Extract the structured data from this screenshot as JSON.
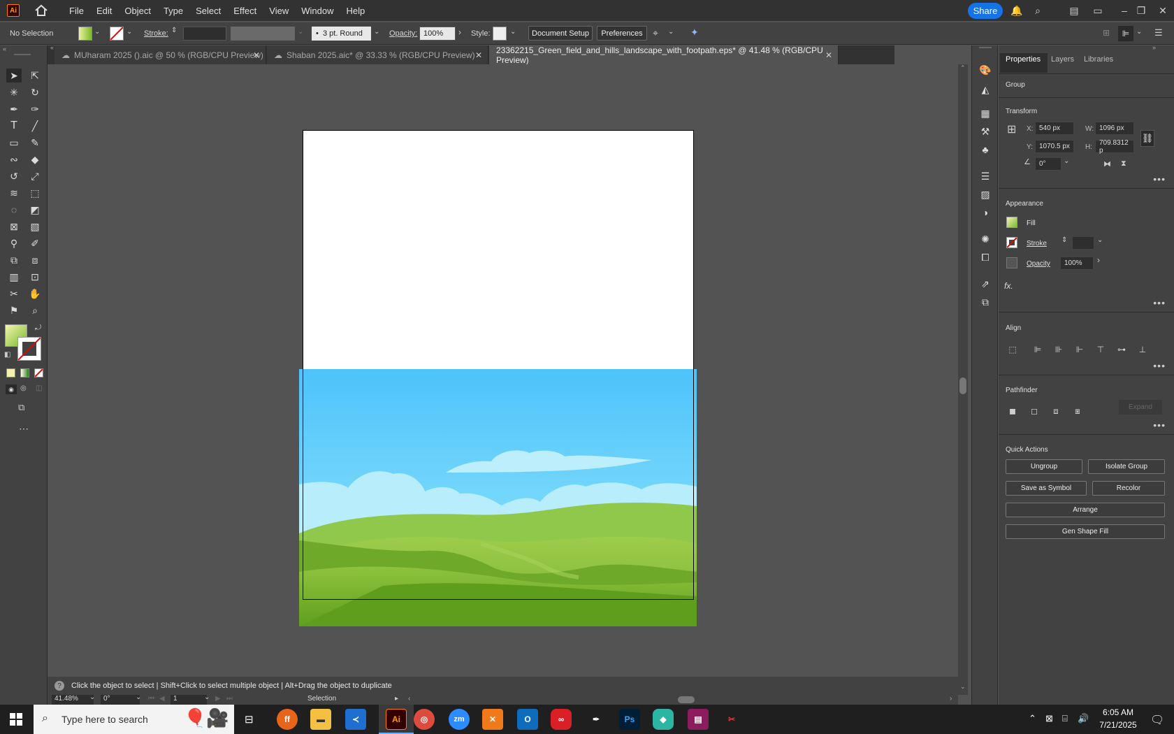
{
  "app": {
    "logo": "Ai"
  },
  "menu": [
    "File",
    "Edit",
    "Object",
    "Type",
    "Select",
    "Effect",
    "View",
    "Window",
    "Help"
  ],
  "topbar": {
    "share_label": "Share"
  },
  "control": {
    "selection": "No Selection",
    "stroke_label": "Stroke:",
    "brush": "3 pt. Round",
    "opacity_label": "Opacity:",
    "opacity_value": "100%",
    "style_label": "Style:",
    "document_setup": "Document Setup",
    "preferences": "Preferences"
  },
  "tabs": [
    {
      "label": "MUharam 2025 ().aic @ 50 % (RGB/CPU Preview)"
    },
    {
      "label": "Shaban 2025.aic* @ 33.33 % (RGB/CPU Preview)"
    },
    {
      "label": "23362215_Green_field_and_hills_landscape_with_footpath.eps* @ 41.48 % (RGB/CPU Preview)"
    }
  ],
  "status": {
    "hint": "Click the object to select  |  Shift+Click to select multiple object  |  Alt+Drag the object to duplicate",
    "zoom": "41.48%",
    "rotation": "0°",
    "artboard": "1",
    "tool": "Selection"
  },
  "panel": {
    "tabs": [
      "Properties",
      "Layers",
      "Libraries"
    ],
    "object_type": "Group",
    "transform": {
      "title": "Transform",
      "x_label": "X:",
      "x": "540 px",
      "y_label": "Y:",
      "y": "1070.5 px",
      "w_label": "W:",
      "w": "1096 px",
      "h_label": "H:",
      "h": "709.8312 p",
      "angle": "0°"
    },
    "appearance": {
      "title": "Appearance",
      "fill": "Fill",
      "stroke": "Stroke",
      "opacity_label": "Opacity",
      "opacity": "100%",
      "fx": "fx."
    },
    "align": {
      "title": "Align"
    },
    "pathfinder": {
      "title": "Pathfinder",
      "expand": "Expand"
    },
    "quick_actions": {
      "title": "Quick Actions",
      "ungroup": "Ungroup",
      "isolate": "Isolate Group",
      "save_symbol": "Save as Symbol",
      "recolor": "Recolor",
      "arrange": "Arrange",
      "gen_fill": "Gen Shape Fill"
    }
  },
  "taskbar": {
    "search_placeholder": "Type here to search",
    "time": "6:05 AM",
    "date": "7/21/2025"
  },
  "colors": {
    "accent": "#1473e6",
    "sky_top": "#4cc3fb",
    "grass": "#7cb82f",
    "fill_gradient_start": "#e9f0a0",
    "fill_gradient_end": "#7bb92b"
  }
}
